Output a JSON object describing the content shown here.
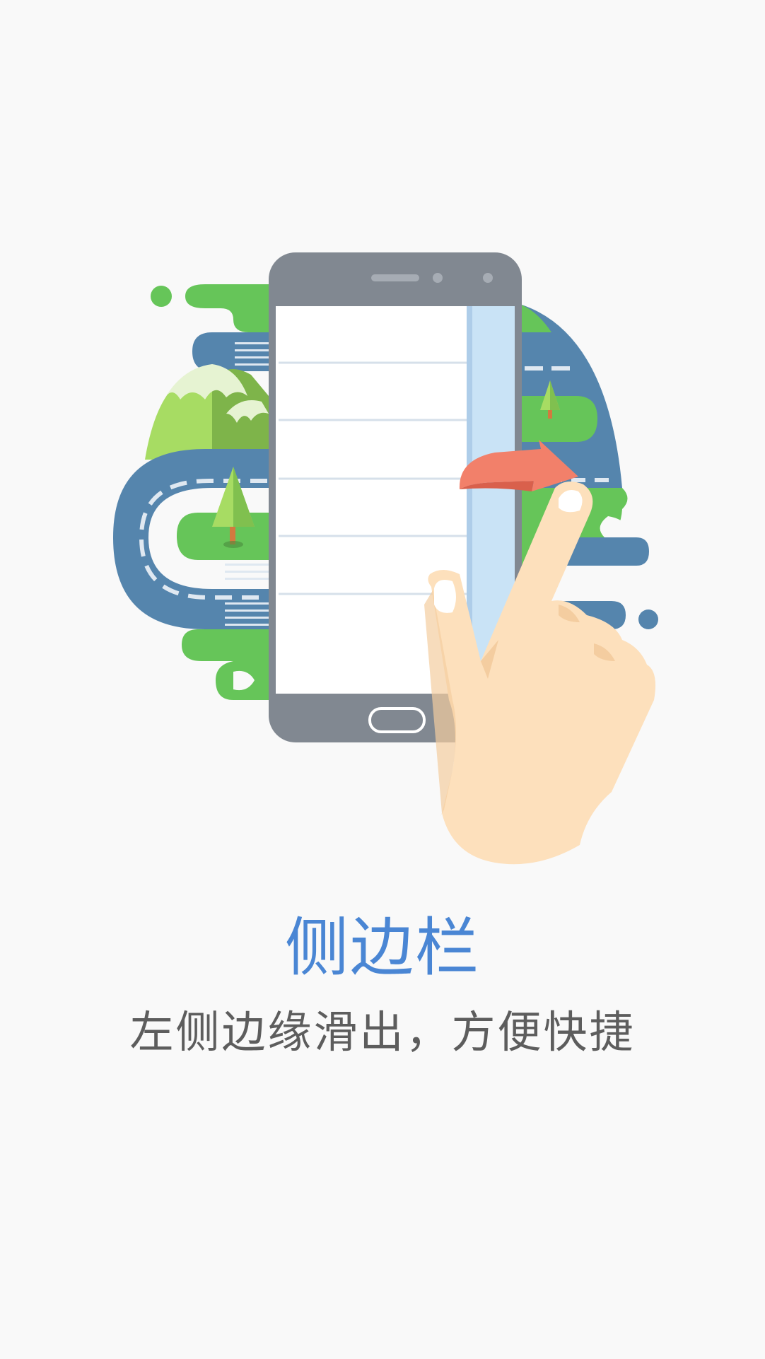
{
  "feature": {
    "title": "侧边栏",
    "description": "左侧边缘滑出，方便快捷"
  },
  "illustration": {
    "subject": "hand-swiping-phone-sidebar",
    "icons": [
      "phone-icon",
      "hand-icon",
      "swipe-arrow-icon",
      "road-landscape-icon",
      "tree-icon",
      "mountain-icon"
    ]
  },
  "colors": {
    "background": "#f9f9f9",
    "title": "#4a86d4",
    "description": "#5d5d5d",
    "phone_body": "#818891",
    "phone_screen": "#fbfbfc",
    "sidebar_panel": "#c9e3f6",
    "road": "#5585ad",
    "grass": "#66c559",
    "arrow": "#f2806a",
    "hand": "#fde0bc"
  }
}
